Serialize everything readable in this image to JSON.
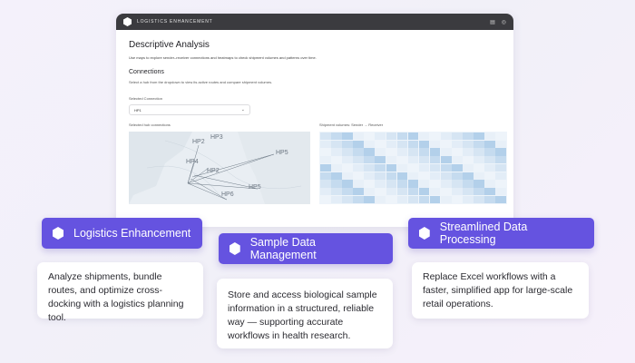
{
  "app": {
    "title": "LOGISTICS ENHANCEMENT",
    "icons": [
      "book-icon",
      "help-icon"
    ]
  },
  "page": {
    "title": "Descriptive Analysis",
    "description": "Use maps to explore sender–receiver connections and heatmaps to check shipment volumes and patterns over time."
  },
  "connections": {
    "title": "Connections",
    "description": "Select a hub from the dropdown to view its active routes and compare shipment volumes.",
    "select_label": "Selected Connection",
    "select_value": "HP1"
  },
  "map_panel": {
    "label": "Selected hub connections",
    "hubs": [
      "HP2",
      "HP3",
      "HP4",
      "HP5",
      "HP2",
      "HP6",
      "HP5"
    ]
  },
  "heatmap_panel": {
    "label": "Shipment volumes: Sender → Receiver"
  },
  "features": [
    {
      "title": "Logistics Enhancement",
      "description": "Analyze shipments, bundle routes, and optimize cross-docking with a logistics planning tool."
    },
    {
      "title": "Sample Data Management",
      "description": "Store and access biological sample information in a structured, reliable way — supporting accurate workflows in health research."
    },
    {
      "title": "Streamlined Data Processing",
      "description": "Replace Excel workflows with a faster, simplified app for large-scale retail operations."
    }
  ],
  "colors": {
    "accent": "#6553e0",
    "titlebar": "#3b3b3f",
    "background": "#f3f1fa"
  }
}
